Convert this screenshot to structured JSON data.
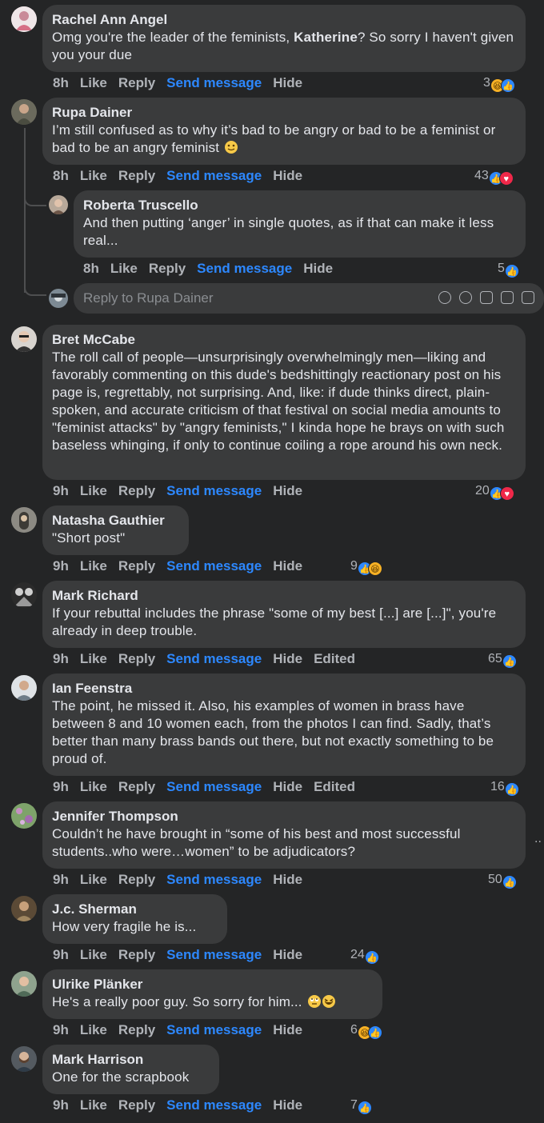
{
  "actions": {
    "like": "Like",
    "reply": "Reply",
    "send_message": "Send message",
    "hide": "Hide",
    "edited": "Edited"
  },
  "comments": [
    {
      "author": "Rachel Ann Angel",
      "text_before": "Omg you're the leader of the feminists, ",
      "text_bold": "Katherine",
      "text_after": "? So sorry I haven't given you your due",
      "time": "8h",
      "reaction_count": "3",
      "reactions": [
        "haha",
        "like"
      ]
    },
    {
      "author": "Rupa Dainer",
      "text": "I’m still confused as to why it’s bad to be angry or bad to be a feminist or bad to be an angry feminist",
      "emoji": "slightly-smiling-face",
      "time": "8h",
      "reaction_count": "43",
      "reactions": [
        "like",
        "love"
      ]
    },
    {
      "author": "Roberta Truscello",
      "text": "And then putting ‘anger’ in single quotes, as if that can make it less real...",
      "time": "8h",
      "reaction_count": "5",
      "reactions": [
        "like"
      ]
    },
    {
      "author": "Bret McCabe",
      "text": "The roll call of people—unsurprisingly overwhelmingly men—liking and favorably commenting on this dude's bedshittingly reactionary post on his page is, regrettably, not surprising. And, like: if dude thinks direct, plain-spoken, and accurate criticism of that festival on social media amounts to \"feminist attacks\" by \"angry feminists,\" I kinda hope he brays on with such baseless whinging, if only to continue coiling a rope around his own neck.",
      "time": "9h",
      "reaction_count": "20",
      "reactions": [
        "like",
        "love"
      ]
    },
    {
      "author": "Natasha Gauthier",
      "text": "\"Short post\"",
      "time": "9h",
      "reaction_count": "9",
      "reactions": [
        "like",
        "haha"
      ]
    },
    {
      "author": "Mark Richard",
      "text": "If your rebuttal includes the phrase \"some of my best [...] are [...]\", you're already in deep trouble.",
      "time": "9h",
      "reaction_count": "65",
      "reactions": [
        "like"
      ]
    },
    {
      "author": "Ian Feenstra",
      "text": "The point, he missed it. Also, his examples of women in brass have between 8 and 10 women each, from the photos I can find. Sadly, that’s better than many brass bands out there, but not exactly something to be proud of.",
      "time": "9h",
      "reaction_count": "16",
      "reactions": [
        "like"
      ]
    },
    {
      "author": "Jennifer Thompson",
      "text": "Couldn’t he have brought in “some of his best and most successful students..who were…women” to be adjudicators?",
      "time": "9h",
      "reaction_count": "50",
      "reactions": [
        "like"
      ]
    },
    {
      "author": "J.c. Sherman",
      "text": "How very fragile he is...",
      "time": "9h",
      "reaction_count": "24",
      "reactions": [
        "like"
      ]
    },
    {
      "author": "Ulrike Plänker",
      "text": "He's a really poor guy. So sorry for him...",
      "emojis": [
        "face-with-rolling-eyes",
        "grinning-squinting-face"
      ],
      "time": "9h",
      "reaction_count": "6",
      "reactions": [
        "haha",
        "like"
      ]
    },
    {
      "author": "Mark Harrison",
      "text": "One for the scrapbook",
      "time": "9h",
      "reaction_count": "7",
      "reactions": [
        "like"
      ]
    }
  ],
  "reply_box": {
    "placeholder": "Reply to Rupa Dainer",
    "icons": [
      "avatar-sticker-icon",
      "emoji-icon",
      "camera-icon",
      "gif-icon",
      "sticker-icon"
    ]
  },
  "more_indicator": ".."
}
